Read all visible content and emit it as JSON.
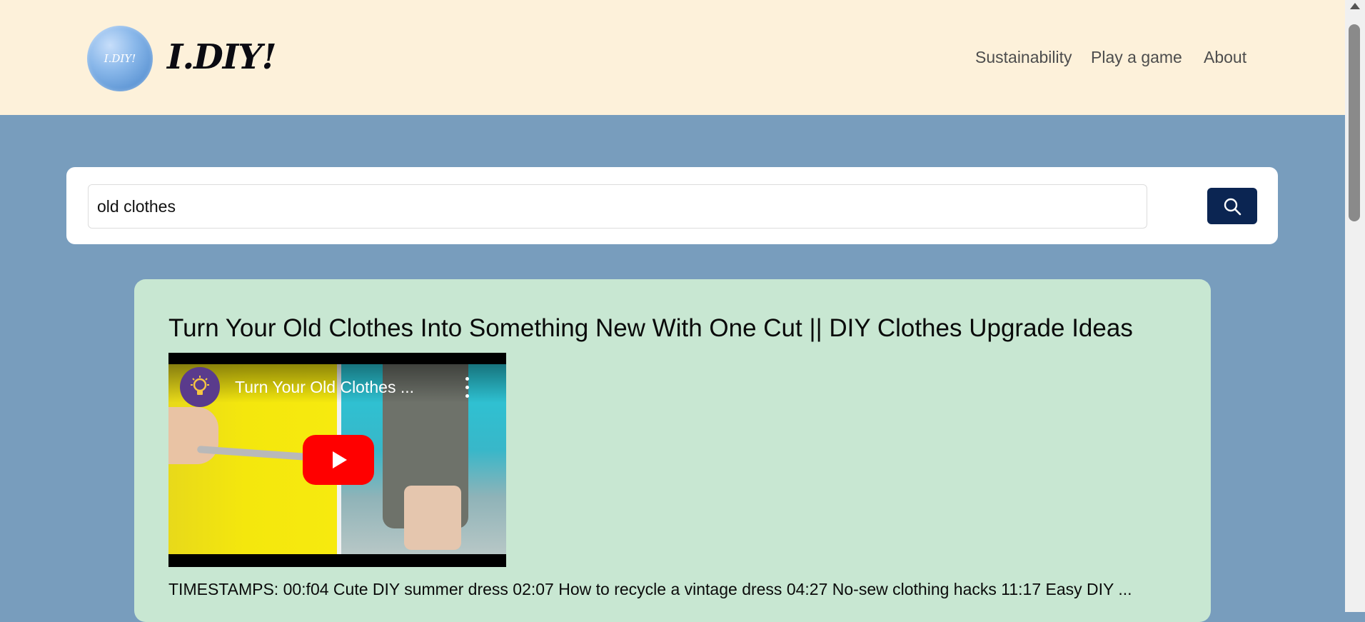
{
  "header": {
    "logo_badge": "I.DIY!",
    "logo_text": "I.DIY!",
    "nav": [
      "Sustainability",
      "Play a game",
      "About"
    ]
  },
  "search": {
    "value": "old clothes",
    "button_icon": "search-icon"
  },
  "result": {
    "title": "Turn Your Old Clothes Into Something New With One Cut || DIY Clothes Upgrade Ideas",
    "video": {
      "title": "Turn Your Old Clothes ...",
      "icons": [
        "lightbulb-icon",
        "more-vert-icon",
        "play-icon"
      ]
    },
    "description": "TIMESTAMPS: 00:f04 Cute DIY summer dress 02:07 How to recycle a vintage dress 04:27 No-sew clothing hacks 11:17 Easy DIY ..."
  },
  "colors": {
    "header_bg": "#fdf1da",
    "page_bg": "#789dbd",
    "card_bg": "#c8e7d2",
    "search_button_bg": "#0b2552"
  }
}
